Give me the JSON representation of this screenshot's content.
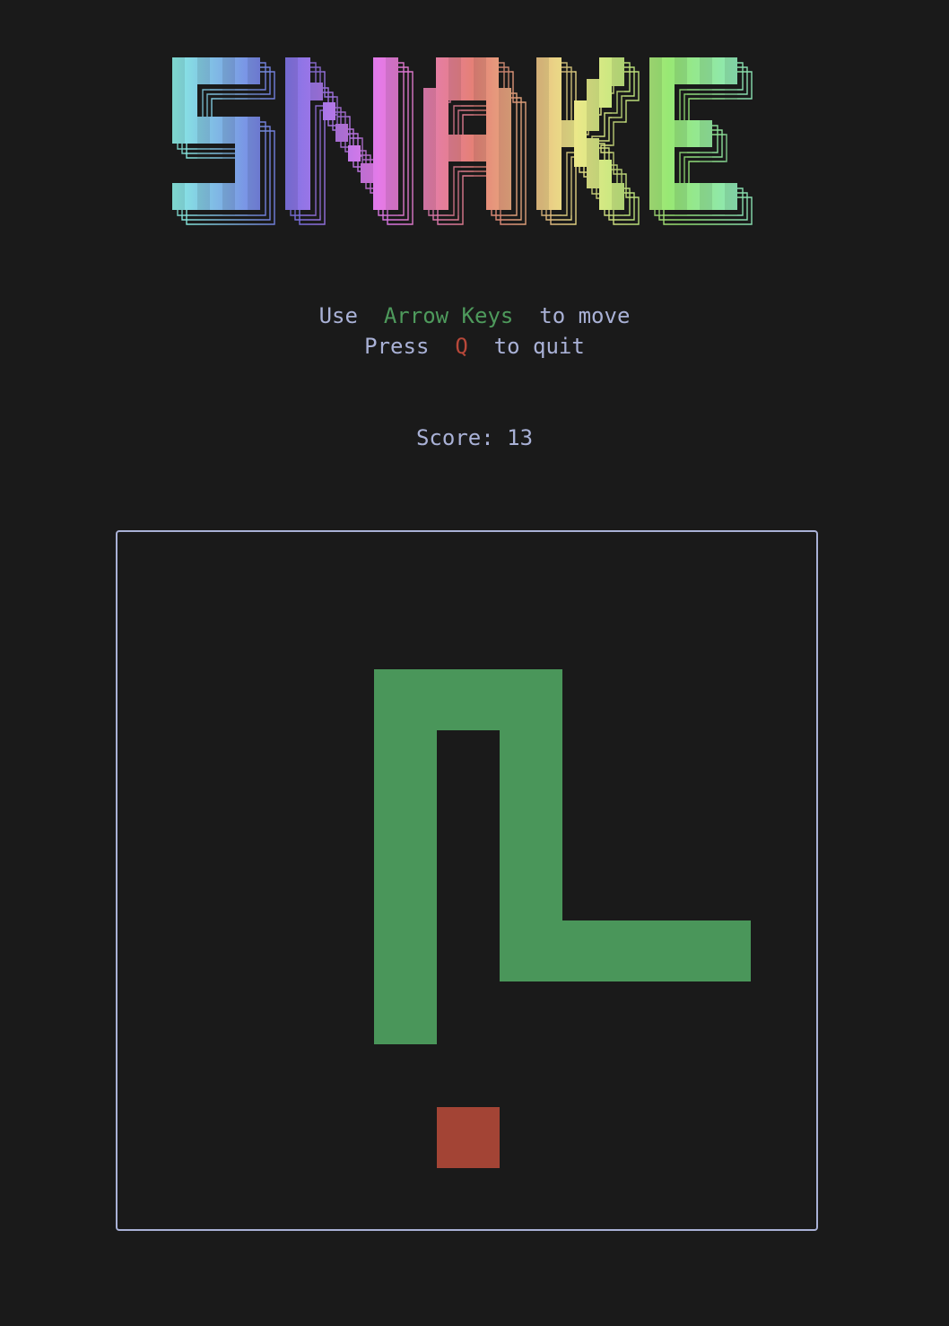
{
  "title": "SNAKE",
  "help": {
    "line1_pre": "Use",
    "line1_key": "Arrow Keys",
    "line1_post": "to move",
    "line2_pre": "Press",
    "line2_key": "Q",
    "line2_post": "to quit"
  },
  "score": {
    "label": "Score:",
    "value": "13"
  },
  "colors": {
    "background": "#1a1a1a",
    "text": "#a9b1d6",
    "key_move": "#4e9a5c",
    "key_quit": "#b8483a",
    "snake": "#4a965a",
    "food": "#a34435",
    "border": "#a9b1d6"
  },
  "game": {
    "snake_cells": [
      [
        4,
        2
      ],
      [
        5,
        2
      ],
      [
        6,
        2
      ],
      [
        4,
        3
      ],
      [
        6,
        3
      ],
      [
        4,
        4
      ],
      [
        6,
        4
      ],
      [
        4,
        5
      ],
      [
        6,
        5
      ],
      [
        4,
        6
      ],
      [
        6,
        6
      ],
      [
        7,
        6
      ],
      [
        8,
        6
      ],
      [
        9,
        6
      ],
      [
        4,
        7
      ]
    ],
    "food_cell": [
      5,
      9
    ]
  }
}
